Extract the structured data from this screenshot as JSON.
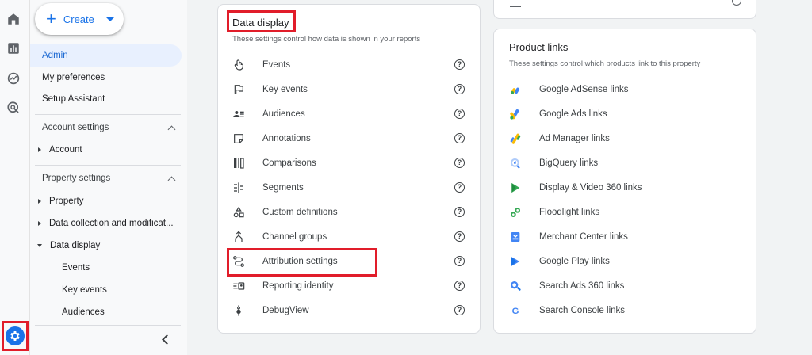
{
  "create_button": {
    "label": "Create"
  },
  "nav": {
    "admin": "Admin",
    "my_preferences": "My preferences",
    "setup_assistant": "Setup Assistant",
    "account_settings": "Account settings",
    "account": "Account",
    "property_settings": "Property settings",
    "property": "Property",
    "data_collection": "Data collection and modificat...",
    "data_display": "Data display",
    "sub_items": [
      "Events",
      "Key events",
      "Audiences"
    ]
  },
  "data_display_card": {
    "title": "Data display",
    "subtitle": "These settings control how data is shown in your reports",
    "items": [
      {
        "label": "Events",
        "icon": "touch-icon"
      },
      {
        "label": "Key events",
        "icon": "flag-icon"
      },
      {
        "label": "Audiences",
        "icon": "audience-icon"
      },
      {
        "label": "Annotations",
        "icon": "note-icon"
      },
      {
        "label": "Comparisons",
        "icon": "compare-icon"
      },
      {
        "label": "Segments",
        "icon": "segments-icon"
      },
      {
        "label": "Custom definitions",
        "icon": "shapes-icon"
      },
      {
        "label": "Channel groups",
        "icon": "merge-icon"
      },
      {
        "label": "Attribution settings",
        "icon": "route-icon"
      },
      {
        "label": "Reporting identity",
        "icon": "identity-icon"
      },
      {
        "label": "DebugView",
        "icon": "debug-icon"
      }
    ]
  },
  "product_links_card": {
    "title": "Product links",
    "subtitle": "These settings control which products link to this property",
    "items": [
      {
        "label": "Google AdSense links",
        "icon": "adsense-icon"
      },
      {
        "label": "Google Ads links",
        "icon": "google-ads-icon"
      },
      {
        "label": "Ad Manager links",
        "icon": "ad-manager-icon"
      },
      {
        "label": "BigQuery links",
        "icon": "bigquery-icon"
      },
      {
        "label": "Display & Video 360 links",
        "icon": "dv360-icon"
      },
      {
        "label": "Floodlight links",
        "icon": "floodlight-icon"
      },
      {
        "label": "Merchant Center links",
        "icon": "merchant-center-icon"
      },
      {
        "label": "Google Play links",
        "icon": "google-play-icon"
      },
      {
        "label": "Search Ads 360 links",
        "icon": "search-ads-360-icon"
      },
      {
        "label": "Search Console links",
        "icon": "search-console-icon"
      }
    ]
  },
  "colors": {
    "accent": "#1a73e8",
    "highlight": "#e11d2a",
    "active_bg": "#e8f0fe"
  }
}
